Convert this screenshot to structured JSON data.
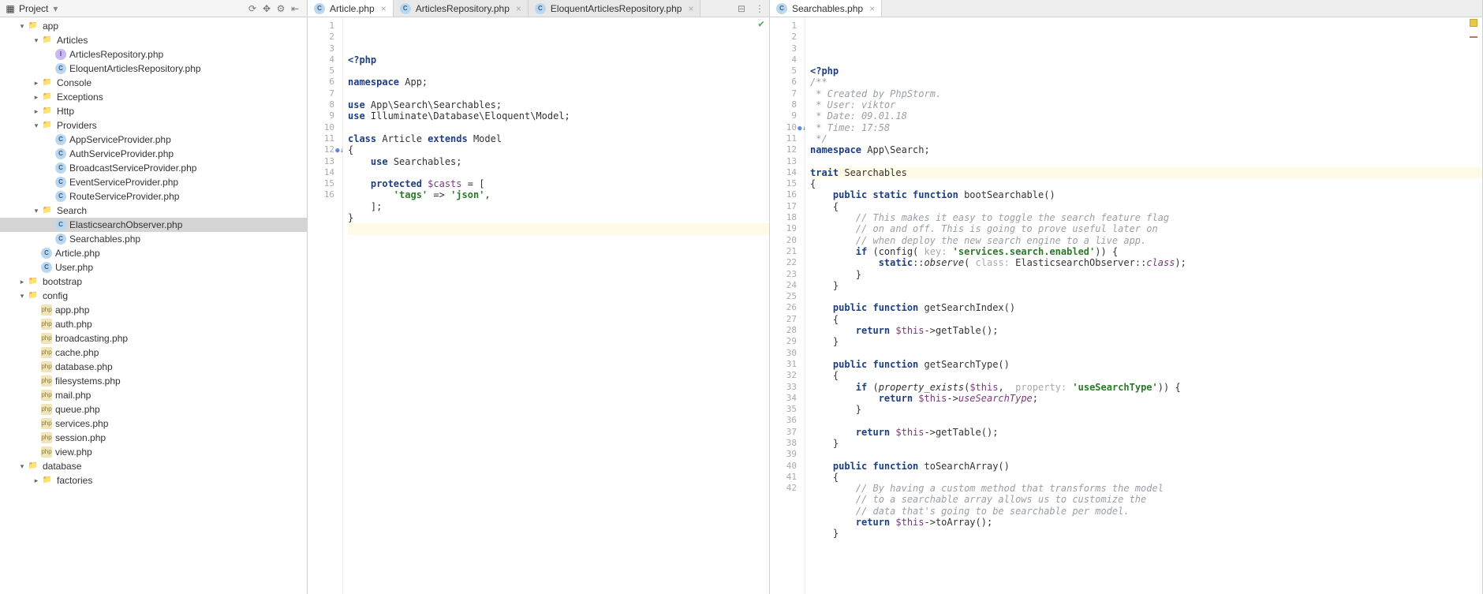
{
  "sidebar": {
    "title": "Project",
    "tools": [
      "⟳",
      "✥",
      "⚙",
      "⇤"
    ],
    "tree": [
      {
        "depth": 0,
        "arrow": "▾",
        "icon": "folder",
        "label": "app"
      },
      {
        "depth": 1,
        "arrow": "▾",
        "icon": "folder",
        "label": "Articles"
      },
      {
        "depth": 2,
        "arrow": "",
        "icon": "interface",
        "label": "ArticlesRepository.php"
      },
      {
        "depth": 2,
        "arrow": "",
        "icon": "class",
        "label": "EloquentArticlesRepository.php"
      },
      {
        "depth": 1,
        "arrow": "▸",
        "icon": "folder",
        "label": "Console"
      },
      {
        "depth": 1,
        "arrow": "▸",
        "icon": "folder",
        "label": "Exceptions"
      },
      {
        "depth": 1,
        "arrow": "▸",
        "icon": "folder",
        "label": "Http"
      },
      {
        "depth": 1,
        "arrow": "▾",
        "icon": "folder",
        "label": "Providers"
      },
      {
        "depth": 2,
        "arrow": "",
        "icon": "class",
        "label": "AppServiceProvider.php"
      },
      {
        "depth": 2,
        "arrow": "",
        "icon": "class",
        "label": "AuthServiceProvider.php"
      },
      {
        "depth": 2,
        "arrow": "",
        "icon": "class",
        "label": "BroadcastServiceProvider.php"
      },
      {
        "depth": 2,
        "arrow": "",
        "icon": "class",
        "label": "EventServiceProvider.php"
      },
      {
        "depth": 2,
        "arrow": "",
        "icon": "class",
        "label": "RouteServiceProvider.php"
      },
      {
        "depth": 1,
        "arrow": "▾",
        "icon": "folder",
        "label": "Search"
      },
      {
        "depth": 2,
        "arrow": "",
        "icon": "class",
        "label": "ElasticsearchObserver.php",
        "selected": true
      },
      {
        "depth": 2,
        "arrow": "",
        "icon": "class",
        "label": "Searchables.php"
      },
      {
        "depth": 1,
        "arrow": "",
        "icon": "class",
        "label": "Article.php"
      },
      {
        "depth": 1,
        "arrow": "",
        "icon": "class",
        "label": "User.php"
      },
      {
        "depth": 0,
        "arrow": "▸",
        "icon": "folder",
        "label": "bootstrap"
      },
      {
        "depth": 0,
        "arrow": "▾",
        "icon": "folder",
        "label": "config"
      },
      {
        "depth": 1,
        "arrow": "",
        "icon": "cfg",
        "label": "app.php"
      },
      {
        "depth": 1,
        "arrow": "",
        "icon": "cfg",
        "label": "auth.php"
      },
      {
        "depth": 1,
        "arrow": "",
        "icon": "cfg",
        "label": "broadcasting.php"
      },
      {
        "depth": 1,
        "arrow": "",
        "icon": "cfg",
        "label": "cache.php"
      },
      {
        "depth": 1,
        "arrow": "",
        "icon": "cfg",
        "label": "database.php"
      },
      {
        "depth": 1,
        "arrow": "",
        "icon": "cfg",
        "label": "filesystems.php"
      },
      {
        "depth": 1,
        "arrow": "",
        "icon": "cfg",
        "label": "mail.php"
      },
      {
        "depth": 1,
        "arrow": "",
        "icon": "cfg",
        "label": "queue.php"
      },
      {
        "depth": 1,
        "arrow": "",
        "icon": "cfg",
        "label": "services.php"
      },
      {
        "depth": 1,
        "arrow": "",
        "icon": "cfg",
        "label": "session.php"
      },
      {
        "depth": 1,
        "arrow": "",
        "icon": "cfg",
        "label": "view.php"
      },
      {
        "depth": 0,
        "arrow": "▾",
        "icon": "folder",
        "label": "database"
      },
      {
        "depth": 1,
        "arrow": "▸",
        "icon": "folder",
        "label": "factories"
      }
    ]
  },
  "left_pane": {
    "tabs": [
      {
        "label": "Article.php",
        "active": true
      },
      {
        "label": "ArticlesRepository.php",
        "active": false
      },
      {
        "label": "EloquentArticlesRepository.php",
        "active": false
      }
    ],
    "line_start": 1,
    "line_end": 16,
    "gutter_marks": {
      "12": "blue"
    },
    "code": [
      [
        [
          "kw",
          "<?php"
        ]
      ],
      [],
      [
        [
          "kw",
          "namespace "
        ],
        [
          "fn",
          "App;"
        ]
      ],
      [],
      [
        [
          "kw",
          "use "
        ],
        [
          "fn",
          "App\\Search\\Searchables;"
        ]
      ],
      [
        [
          "kw",
          "use "
        ],
        [
          "fn",
          "Illuminate\\Database\\Eloquent\\Model;"
        ]
      ],
      [],
      [
        [
          "kw",
          "class "
        ],
        [
          "fn",
          "Article "
        ],
        [
          "kw",
          "extends "
        ],
        [
          "fn",
          "Model"
        ]
      ],
      [
        [
          "fn",
          "{"
        ]
      ],
      [
        [
          "fn",
          "    "
        ],
        [
          "kw",
          "use "
        ],
        [
          "fn",
          "Searchables;"
        ]
      ],
      [],
      [
        [
          "fn",
          "    "
        ],
        [
          "kw",
          "protected "
        ],
        [
          "var",
          "$casts"
        ],
        [
          "fn",
          " = ["
        ]
      ],
      [
        [
          "fn",
          "        "
        ],
        [
          "str",
          "'tags'"
        ],
        [
          "fn",
          " => "
        ],
        [
          "str",
          "'json'"
        ],
        [
          "fn",
          ","
        ]
      ],
      [
        [
          "fn",
          "    ];"
        ]
      ],
      [
        [
          "fn",
          "}"
        ]
      ],
      []
    ],
    "highlight_line": 16
  },
  "right_pane": {
    "tabs": [
      {
        "label": "Searchables.php",
        "active": true
      }
    ],
    "line_start": 1,
    "line_end": 42,
    "gutter_marks": {
      "10": "blue"
    },
    "code": [
      [
        [
          "kw",
          "<?php"
        ]
      ],
      [
        [
          "com",
          "/**"
        ]
      ],
      [
        [
          "com",
          " * Created by PhpStorm."
        ]
      ],
      [
        [
          "com",
          " * User: viktor"
        ]
      ],
      [
        [
          "com",
          " * Date: 09.01.18"
        ]
      ],
      [
        [
          "com",
          " * Time: 17:58"
        ]
      ],
      [
        [
          "com",
          " */"
        ]
      ],
      [
        [
          "kw",
          "namespace "
        ],
        [
          "fn",
          "App\\Search;"
        ]
      ],
      [],
      [
        [
          "kw",
          "trait "
        ],
        [
          "fn",
          "Searchables"
        ]
      ],
      [
        [
          "fn",
          "{"
        ]
      ],
      [
        [
          "fn",
          "    "
        ],
        [
          "kw",
          "public static function "
        ],
        [
          "fn",
          "bootSearchable()"
        ]
      ],
      [
        [
          "fn",
          "    {"
        ]
      ],
      [
        [
          "fn",
          "        "
        ],
        [
          "com",
          "// This makes it easy to toggle the search feature flag"
        ]
      ],
      [
        [
          "fn",
          "        "
        ],
        [
          "com",
          "// on and off. This is going to prove useful later on"
        ]
      ],
      [
        [
          "fn",
          "        "
        ],
        [
          "com",
          "// when deploy the new search engine to a live app."
        ]
      ],
      [
        [
          "fn",
          "        "
        ],
        [
          "kw",
          "if "
        ],
        [
          "fn",
          "(config( "
        ],
        [
          "hint",
          "key: "
        ],
        [
          "str",
          "'services.search.enabled'"
        ],
        [
          "fn",
          ")) {"
        ]
      ],
      [
        [
          "fn",
          "            "
        ],
        [
          "kw",
          "static"
        ],
        [
          "fn",
          "::"
        ],
        [
          "italic",
          "observe"
        ],
        [
          "fn",
          "( "
        ],
        [
          "hint",
          "class: "
        ],
        [
          "fn",
          "ElasticsearchObserver::"
        ],
        [
          "purple",
          "class"
        ],
        [
          "fn",
          ");"
        ]
      ],
      [
        [
          "fn",
          "        }"
        ]
      ],
      [
        [
          "fn",
          "    }"
        ]
      ],
      [],
      [
        [
          "fn",
          "    "
        ],
        [
          "kw",
          "public function "
        ],
        [
          "fn",
          "getSearchIndex()"
        ]
      ],
      [
        [
          "fn",
          "    {"
        ]
      ],
      [
        [
          "fn",
          "        "
        ],
        [
          "kw",
          "return "
        ],
        [
          "var",
          "$this"
        ],
        [
          "fn",
          "->getTable();"
        ]
      ],
      [
        [
          "fn",
          "    }"
        ]
      ],
      [],
      [
        [
          "fn",
          "    "
        ],
        [
          "kw",
          "public function "
        ],
        [
          "fn",
          "getSearchType()"
        ]
      ],
      [
        [
          "fn",
          "    {"
        ]
      ],
      [
        [
          "fn",
          "        "
        ],
        [
          "kw",
          "if "
        ],
        [
          "fn",
          "("
        ],
        [
          "italic",
          "property_exists"
        ],
        [
          "fn",
          "("
        ],
        [
          "var",
          "$this"
        ],
        [
          "fn",
          ",  "
        ],
        [
          "hint",
          "property: "
        ],
        [
          "str",
          "'useSearchType'"
        ],
        [
          "fn",
          ")) {"
        ]
      ],
      [
        [
          "fn",
          "            "
        ],
        [
          "kw",
          "return "
        ],
        [
          "var",
          "$this"
        ],
        [
          "fn",
          "->"
        ],
        [
          "purple",
          "useSearchType"
        ],
        [
          "fn",
          ";"
        ]
      ],
      [
        [
          "fn",
          "        }"
        ]
      ],
      [],
      [
        [
          "fn",
          "        "
        ],
        [
          "kw",
          "return "
        ],
        [
          "var",
          "$this"
        ],
        [
          "fn",
          "->getTable();"
        ]
      ],
      [
        [
          "fn",
          "    }"
        ]
      ],
      [],
      [
        [
          "fn",
          "    "
        ],
        [
          "kw",
          "public function "
        ],
        [
          "fn",
          "toSearchArray()"
        ]
      ],
      [
        [
          "fn",
          "    {"
        ]
      ],
      [
        [
          "fn",
          "        "
        ],
        [
          "com",
          "// By having a custom method that transforms the model"
        ]
      ],
      [
        [
          "fn",
          "        "
        ],
        [
          "com",
          "// to a searchable array allows us to customize the"
        ]
      ],
      [
        [
          "fn",
          "        "
        ],
        [
          "com",
          "// data that's going to be searchable per model."
        ]
      ],
      [
        [
          "fn",
          "        "
        ],
        [
          "kw",
          "return "
        ],
        [
          "var",
          "$this"
        ],
        [
          "fn",
          "->toArray();"
        ]
      ],
      [
        [
          "fn",
          "    }"
        ]
      ]
    ],
    "highlight_line": 10
  }
}
